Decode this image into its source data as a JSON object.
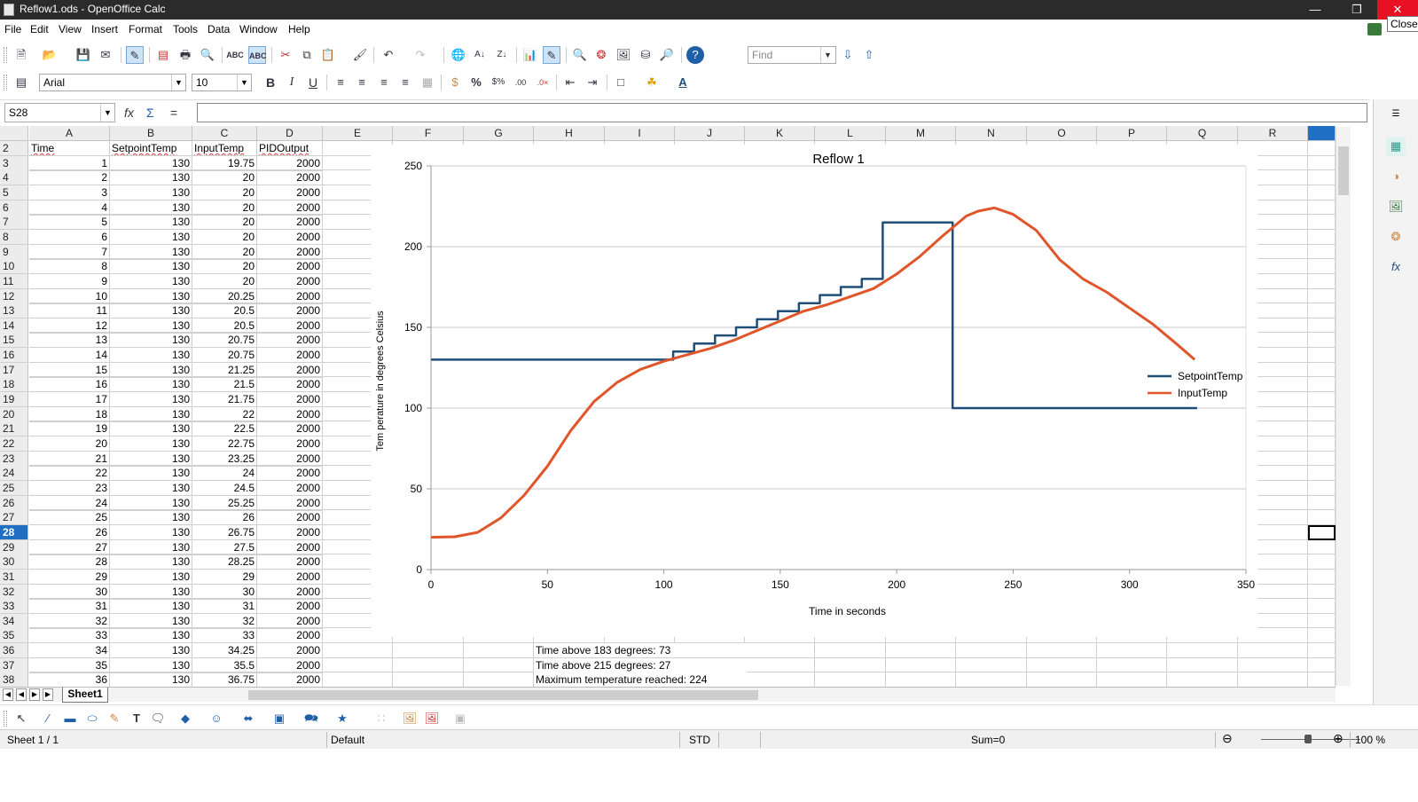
{
  "window": {
    "title": "Reflow1.ods - OpenOffice Calc",
    "close_tooltip": "Close"
  },
  "menu": [
    "File",
    "Edit",
    "View",
    "Insert",
    "Format",
    "Tools",
    "Data",
    "Window",
    "Help"
  ],
  "find_toolbar": {
    "placeholder": "Find"
  },
  "format_toolbar": {
    "font_name": "Arial",
    "font_size": "10"
  },
  "formula_bar": {
    "cell_ref": "S28",
    "content": ""
  },
  "columns": [
    "A",
    "B",
    "C",
    "D",
    "E",
    "F",
    "G",
    "H",
    "I",
    "J",
    "K",
    "L",
    "M",
    "N",
    "O",
    "P",
    "Q",
    "R"
  ],
  "sheet": {
    "header_row_number": 2,
    "headers": [
      "Time",
      "SetpointTemp",
      "InputTemp",
      "PIDOutput"
    ],
    "selected_row": 28,
    "rows": [
      {
        "r": 3,
        "a": "1",
        "b": "130",
        "c": "19.75",
        "d": "2000"
      },
      {
        "r": 4,
        "a": "2",
        "b": "130",
        "c": "20",
        "d": "2000"
      },
      {
        "r": 5,
        "a": "3",
        "b": "130",
        "c": "20",
        "d": "2000"
      },
      {
        "r": 6,
        "a": "4",
        "b": "130",
        "c": "20",
        "d": "2000"
      },
      {
        "r": 7,
        "a": "5",
        "b": "130",
        "c": "20",
        "d": "2000"
      },
      {
        "r": 8,
        "a": "6",
        "b": "130",
        "c": "20",
        "d": "2000"
      },
      {
        "r": 9,
        "a": "7",
        "b": "130",
        "c": "20",
        "d": "2000"
      },
      {
        "r": 10,
        "a": "8",
        "b": "130",
        "c": "20",
        "d": "2000"
      },
      {
        "r": 11,
        "a": "9",
        "b": "130",
        "c": "20",
        "d": "2000"
      },
      {
        "r": 12,
        "a": "10",
        "b": "130",
        "c": "20.25",
        "d": "2000"
      },
      {
        "r": 13,
        "a": "11",
        "b": "130",
        "c": "20.5",
        "d": "2000"
      },
      {
        "r": 14,
        "a": "12",
        "b": "130",
        "c": "20.5",
        "d": "2000"
      },
      {
        "r": 15,
        "a": "13",
        "b": "130",
        "c": "20.75",
        "d": "2000"
      },
      {
        "r": 16,
        "a": "14",
        "b": "130",
        "c": "20.75",
        "d": "2000"
      },
      {
        "r": 17,
        "a": "15",
        "b": "130",
        "c": "21.25",
        "d": "2000"
      },
      {
        "r": 18,
        "a": "16",
        "b": "130",
        "c": "21.5",
        "d": "2000"
      },
      {
        "r": 19,
        "a": "17",
        "b": "130",
        "c": "21.75",
        "d": "2000"
      },
      {
        "r": 20,
        "a": "18",
        "b": "130",
        "c": "22",
        "d": "2000"
      },
      {
        "r": 21,
        "a": "19",
        "b": "130",
        "c": "22.5",
        "d": "2000"
      },
      {
        "r": 22,
        "a": "20",
        "b": "130",
        "c": "22.75",
        "d": "2000"
      },
      {
        "r": 23,
        "a": "21",
        "b": "130",
        "c": "23.25",
        "d": "2000"
      },
      {
        "r": 24,
        "a": "22",
        "b": "130",
        "c": "24",
        "d": "2000"
      },
      {
        "r": 25,
        "a": "23",
        "b": "130",
        "c": "24.5",
        "d": "2000"
      },
      {
        "r": 26,
        "a": "24",
        "b": "130",
        "c": "25.25",
        "d": "2000"
      },
      {
        "r": 27,
        "a": "25",
        "b": "130",
        "c": "26",
        "d": "2000"
      },
      {
        "r": 28,
        "a": "26",
        "b": "130",
        "c": "26.75",
        "d": "2000"
      },
      {
        "r": 29,
        "a": "27",
        "b": "130",
        "c": "27.5",
        "d": "2000"
      },
      {
        "r": 30,
        "a": "28",
        "b": "130",
        "c": "28.25",
        "d": "2000"
      },
      {
        "r": 31,
        "a": "29",
        "b": "130",
        "c": "29",
        "d": "2000"
      },
      {
        "r": 32,
        "a": "30",
        "b": "130",
        "c": "30",
        "d": "2000"
      },
      {
        "r": 33,
        "a": "31",
        "b": "130",
        "c": "31",
        "d": "2000"
      },
      {
        "r": 34,
        "a": "32",
        "b": "130",
        "c": "32",
        "d": "2000"
      },
      {
        "r": 35,
        "a": "33",
        "b": "130",
        "c": "33",
        "d": "2000"
      },
      {
        "r": 36,
        "a": "34",
        "b": "130",
        "c": "34.25",
        "d": "2000"
      },
      {
        "r": 37,
        "a": "35",
        "b": "130",
        "c": "35.5",
        "d": "2000"
      },
      {
        "r": 38,
        "a": "36",
        "b": "130",
        "c": "36.75",
        "d": "2000"
      }
    ],
    "notes": [
      {
        "row": 36,
        "text": "Time above 183 degrees: 73"
      },
      {
        "row": 37,
        "text": "Time above 215 degrees: 27"
      },
      {
        "row": 38,
        "text": "Maximum temperature reached: 224"
      }
    ],
    "tab_name": "Sheet1"
  },
  "chart_data": {
    "type": "line",
    "title": "Reflow 1",
    "xlabel": "Time in seconds",
    "ylabel": "Tem perature in degrees Celsius",
    "xlim": [
      0,
      350
    ],
    "ylim": [
      0,
      250
    ],
    "x_ticks": [
      0,
      50,
      100,
      150,
      200,
      250,
      300,
      350
    ],
    "y_ticks": [
      0,
      50,
      100,
      150,
      200,
      250
    ],
    "grid": true,
    "legend": "right",
    "series": [
      {
        "name": "SetpointTemp",
        "color": "#1f4e79",
        "points": [
          [
            0,
            130
          ],
          [
            104,
            130
          ],
          [
            104,
            135
          ],
          [
            113,
            135
          ],
          [
            113,
            140
          ],
          [
            122,
            140
          ],
          [
            122,
            145
          ],
          [
            131,
            145
          ],
          [
            131,
            150
          ],
          [
            140,
            150
          ],
          [
            140,
            155
          ],
          [
            149,
            155
          ],
          [
            149,
            160
          ],
          [
            158,
            160
          ],
          [
            158,
            165
          ],
          [
            167,
            165
          ],
          [
            167,
            170
          ],
          [
            176,
            170
          ],
          [
            176,
            175
          ],
          [
            185,
            175
          ],
          [
            185,
            180
          ],
          [
            194,
            180
          ],
          [
            194,
            215
          ],
          [
            224,
            215
          ],
          [
            224,
            100
          ],
          [
            329,
            100
          ]
        ]
      },
      {
        "name": "InputTemp",
        "color": "#e0552a",
        "points": [
          [
            0,
            20
          ],
          [
            10,
            20.3
          ],
          [
            20,
            23
          ],
          [
            30,
            32
          ],
          [
            40,
            46
          ],
          [
            50,
            64
          ],
          [
            60,
            86
          ],
          [
            70,
            104
          ],
          [
            80,
            116
          ],
          [
            90,
            124
          ],
          [
            100,
            129
          ],
          [
            110,
            133
          ],
          [
            120,
            137
          ],
          [
            130,
            142
          ],
          [
            140,
            148
          ],
          [
            150,
            154
          ],
          [
            160,
            160
          ],
          [
            170,
            164
          ],
          [
            180,
            169
          ],
          [
            190,
            174
          ],
          [
            200,
            183
          ],
          [
            210,
            194
          ],
          [
            220,
            207
          ],
          [
            230,
            219
          ],
          [
            235,
            222
          ],
          [
            242,
            224
          ],
          [
            250,
            220
          ],
          [
            260,
            210
          ],
          [
            270,
            192
          ],
          [
            280,
            180
          ],
          [
            290,
            172
          ],
          [
            300,
            162
          ],
          [
            310,
            152
          ],
          [
            320,
            140
          ],
          [
            328,
            130
          ]
        ]
      }
    ]
  },
  "statusbar": {
    "sheet": "Sheet 1 / 1",
    "style": "Default",
    "mode": "STD",
    "sum": "Sum=0",
    "zoom": "100 %"
  }
}
